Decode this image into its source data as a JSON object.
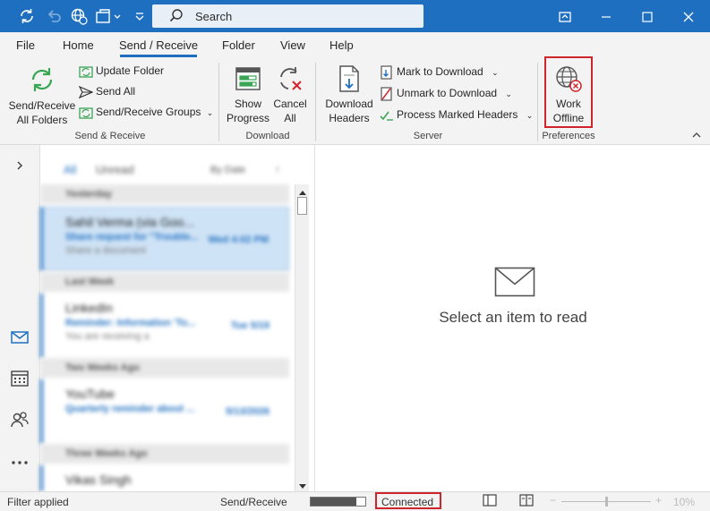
{
  "titlebar": {
    "search_placeholder": "Search",
    "accent": "#1f6fc0"
  },
  "tabs": [
    "File",
    "Home",
    "Send / Receive",
    "Folder",
    "View",
    "Help"
  ],
  "ribbon": {
    "send_receive_all": "Send/Receive\nAll Folders",
    "send_receive_all_l1": "Send/Receive",
    "send_receive_all_l2": "All Folders",
    "update_folder": "Update Folder",
    "send_all": "Send All",
    "send_receive_groups": "Send/Receive Groups",
    "group_send_receive": "Send & Receive",
    "show_progress_l1": "Show",
    "show_progress_l2": "Progress",
    "cancel_all_l1": "Cancel",
    "cancel_all_l2": "All",
    "group_download": "Download",
    "download_headers_l1": "Download",
    "download_headers_l2": "Headers",
    "mark_to_download": "Mark to Download",
    "unmark_to_download": "Unmark to Download",
    "process_marked_headers": "Process Marked Headers",
    "group_server": "Server",
    "work_offline_l1": "Work",
    "work_offline_l2": "Offline",
    "group_preferences": "Preferences"
  },
  "list": {
    "tab_all": "All",
    "tab_unread": "Unread",
    "sort": "By Date",
    "groups": [
      {
        "label": "Yesterday"
      },
      {
        "label": "Last Week"
      },
      {
        "label": "Two Weeks Ago"
      },
      {
        "label": "Three Weeks Ago"
      }
    ],
    "items": [
      {
        "from": "Sahil Verma (via Goo...",
        "subject": "Share request for \"Trouble...",
        "date": "Wed 4:02 PM",
        "preview": "Share a document"
      },
      {
        "from": "LinkedIn",
        "subject": "Reminder: Information 'To...",
        "date": "Tue 5/19",
        "preview": "You are receiving a"
      },
      {
        "from": "YouTube",
        "subject": "Quarterly reminder about ...",
        "date": "5/13/2026",
        "preview": ""
      },
      {
        "from": "Vikas Singh",
        "subject": "",
        "date": "",
        "preview": ""
      }
    ]
  },
  "reading": {
    "empty_message": "Select an item to read"
  },
  "status": {
    "filter": "Filter applied",
    "send_receive": "Send/Receive",
    "connected": "Connected",
    "zoom": "10%"
  }
}
